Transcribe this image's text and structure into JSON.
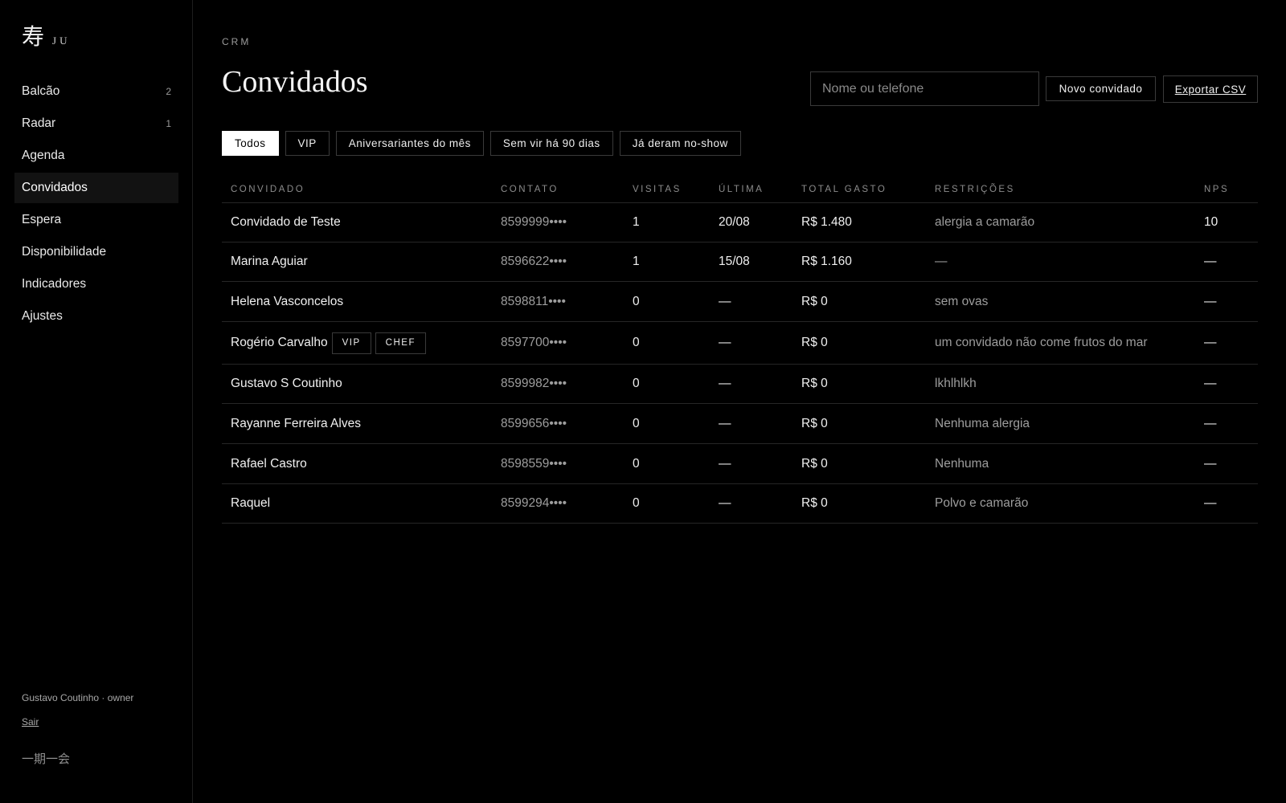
{
  "brand": {
    "mark": "寿",
    "name": "JU"
  },
  "sidebar": {
    "items": [
      {
        "label": "Balcão",
        "count": "2"
      },
      {
        "label": "Radar",
        "count": "1"
      },
      {
        "label": "Agenda",
        "count": ""
      },
      {
        "label": "Convidados",
        "count": ""
      },
      {
        "label": "Espera",
        "count": ""
      },
      {
        "label": "Disponibilidade",
        "count": ""
      },
      {
        "label": "Indicadores",
        "count": ""
      },
      {
        "label": "Ajustes",
        "count": ""
      }
    ],
    "active": "Convidados",
    "user": "Gustavo Coutinho · owner",
    "logout": "Sair",
    "motto": "一期一会"
  },
  "header": {
    "eyebrow": "CRM",
    "title": "Convidados",
    "search_placeholder": "Nome ou telefone",
    "new_label": "Novo convidado",
    "export_label": "Exportar CSV"
  },
  "filters": [
    {
      "label": "Todos",
      "active": true
    },
    {
      "label": "VIP",
      "active": false
    },
    {
      "label": "Aniversariantes do mês",
      "active": false
    },
    {
      "label": "Sem vir há 90 dias",
      "active": false
    },
    {
      "label": "Já deram no-show",
      "active": false
    }
  ],
  "table": {
    "columns": [
      "CONVIDADO",
      "CONTATO",
      "VISITAS",
      "ÚLTIMA",
      "TOTAL GASTO",
      "RESTRIÇÕES",
      "NPS"
    ],
    "rows": [
      {
        "name": "Convidado de Teste",
        "tags": [],
        "contact": "8599999••••",
        "visits": "1",
        "last": "20/08",
        "total": "R$ 1.480",
        "restrictions": "alergia a camarão",
        "nps": "10"
      },
      {
        "name": "Marina Aguiar",
        "tags": [],
        "contact": "8596622••••",
        "visits": "1",
        "last": "15/08",
        "total": "R$ 1.160",
        "restrictions": "—",
        "nps": "—"
      },
      {
        "name": "Helena Vasconcelos",
        "tags": [],
        "contact": "8598811••••",
        "visits": "0",
        "last": "—",
        "total": "R$ 0",
        "restrictions": "sem ovas",
        "nps": "—"
      },
      {
        "name": "Rogério Carvalho",
        "tags": [
          "VIP",
          "CHEF"
        ],
        "contact": "8597700••••",
        "visits": "0",
        "last": "—",
        "total": "R$ 0",
        "restrictions": "um convidado não come frutos do mar",
        "nps": "—"
      },
      {
        "name": "Gustavo S Coutinho",
        "tags": [],
        "contact": "8599982••••",
        "visits": "0",
        "last": "—",
        "total": "R$ 0",
        "restrictions": "lkhlhlkh",
        "nps": "—"
      },
      {
        "name": "Rayanne Ferreira Alves",
        "tags": [],
        "contact": "8599656••••",
        "visits": "0",
        "last": "—",
        "total": "R$ 0",
        "restrictions": "Nenhuma alergia",
        "nps": "—"
      },
      {
        "name": "Rafael Castro",
        "tags": [],
        "contact": "8598559••••",
        "visits": "0",
        "last": "—",
        "total": "R$ 0",
        "restrictions": "Nenhuma",
        "nps": "—"
      },
      {
        "name": "Raquel",
        "tags": [],
        "contact": "8599294••••",
        "visits": "0",
        "last": "—",
        "total": "R$ 0",
        "restrictions": "Polvo e camarão",
        "nps": "—"
      }
    ]
  }
}
